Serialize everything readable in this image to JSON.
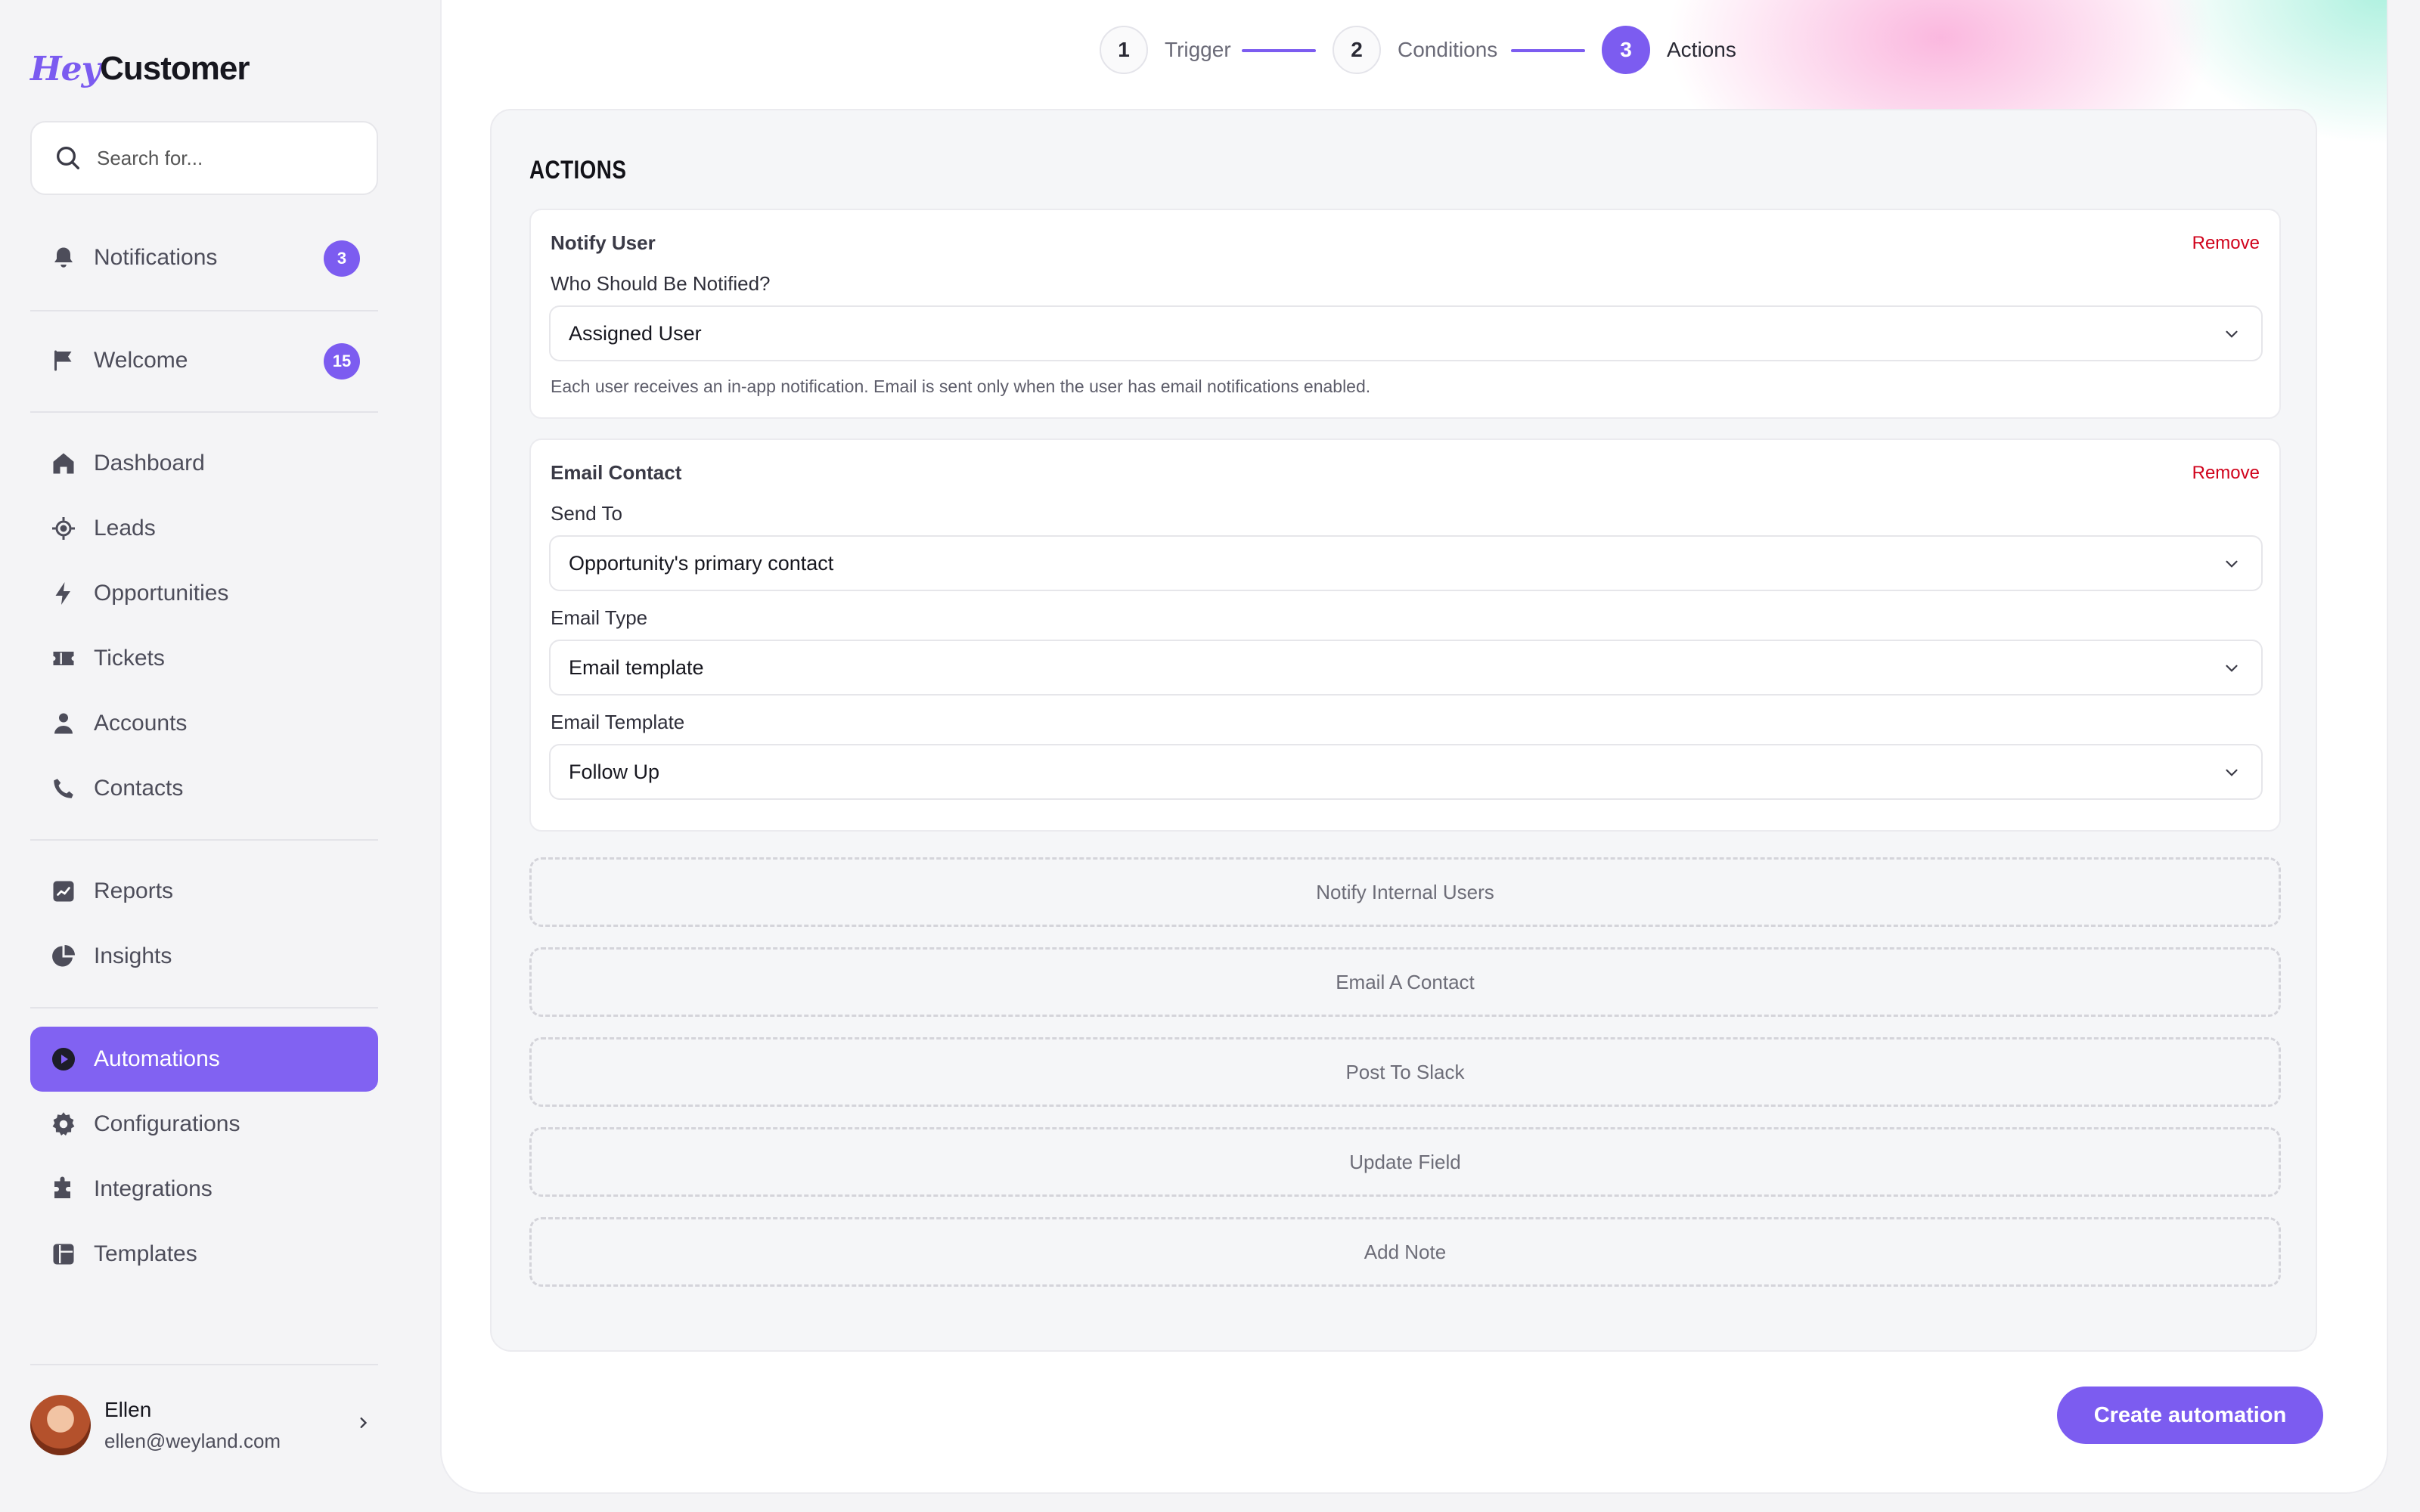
{
  "brand": {
    "hey": "Hey",
    "customer": "Customer",
    "accent": "#7c5cf0"
  },
  "search": {
    "placeholder": "Search for..."
  },
  "sidebar": {
    "top": [
      {
        "label": "Notifications",
        "icon": "bell-icon",
        "badge": "3"
      },
      {
        "label": "Welcome",
        "icon": "flag-icon",
        "badge": "15"
      }
    ],
    "main": [
      {
        "label": "Dashboard",
        "icon": "home-icon"
      },
      {
        "label": "Leads",
        "icon": "target-icon"
      },
      {
        "label": "Opportunities",
        "icon": "bolt-icon"
      },
      {
        "label": "Tickets",
        "icon": "ticket-icon"
      },
      {
        "label": "Accounts",
        "icon": "person-icon"
      },
      {
        "label": "Contacts",
        "icon": "phone-icon"
      }
    ],
    "analytics": [
      {
        "label": "Reports",
        "icon": "chart-icon"
      },
      {
        "label": "Insights",
        "icon": "pie-icon"
      }
    ],
    "settings": [
      {
        "label": "Automations",
        "icon": "play-icon",
        "active": true
      },
      {
        "label": "Configurations",
        "icon": "gear-icon"
      },
      {
        "label": "Integrations",
        "icon": "puzzle-icon"
      },
      {
        "label": "Templates",
        "icon": "template-icon"
      }
    ]
  },
  "user": {
    "name": "Ellen",
    "email": "ellen@weyland.com"
  },
  "stepper": {
    "steps": [
      {
        "number": "1",
        "label": "Trigger"
      },
      {
        "number": "2",
        "label": "Conditions"
      },
      {
        "number": "3",
        "label": "Actions",
        "active": true
      }
    ]
  },
  "actions": {
    "title": "ACTIONS",
    "remove_label": "Remove",
    "notify_user": {
      "title": "Notify User",
      "field_label": "Who Should Be Notified?",
      "value": "Assigned User",
      "hint": "Each user receives an in-app notification. Email is sent only when the user has email notifications enabled."
    },
    "email_contact": {
      "title": "Email Contact",
      "send_to_label": "Send To",
      "send_to_value": "Opportunity's primary contact",
      "email_type_label": "Email Type",
      "email_type_value": "Email template",
      "email_template_label": "Email Template",
      "email_template_value": "Follow Up"
    },
    "add_buttons": [
      "Notify Internal Users",
      "Email A Contact",
      "Post To Slack",
      "Update Field",
      "Add Note"
    ]
  },
  "create_button": "Create automation"
}
